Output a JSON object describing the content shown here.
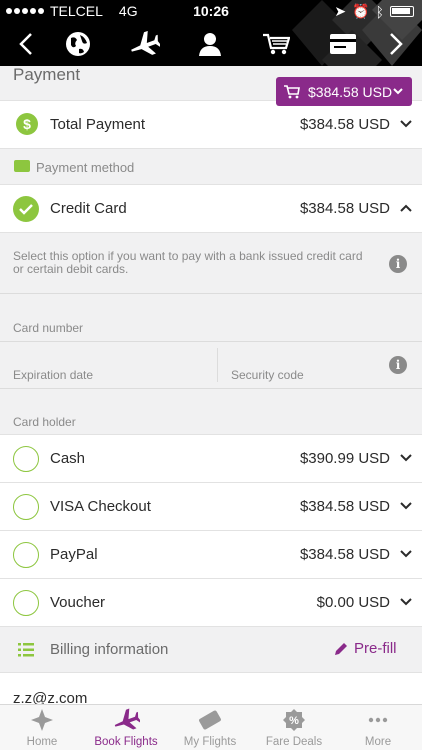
{
  "status": {
    "carrier": "TELCEL",
    "network": "4G",
    "time": "10:26"
  },
  "nav": {
    "items": [
      "back",
      "globe",
      "flight",
      "user",
      "cart",
      "payment",
      "forward"
    ]
  },
  "page": {
    "title": "Payment",
    "cart_total": "$384.58 USD"
  },
  "total": {
    "label": "Total Payment",
    "amount": "$384.58 USD"
  },
  "payment_method": {
    "label": "Payment method"
  },
  "credit_card": {
    "label": "Credit Card",
    "amount": "$384.58 USD",
    "description": "Select this option if you want to pay with a bank issued credit card or certain debit cards.",
    "fields": {
      "card_number": "Card number",
      "expiration": "Expiration date",
      "security": "Security code",
      "holder": "Card holder"
    }
  },
  "options": [
    {
      "label": "Cash",
      "amount": "$390.99 USD"
    },
    {
      "label": "VISA Checkout",
      "amount": "$384.58 USD"
    },
    {
      "label": "PayPal",
      "amount": "$384.58 USD"
    },
    {
      "label": "Voucher",
      "amount": "$0.00 USD"
    }
  ],
  "billing": {
    "label": "Billing information",
    "prefill": "Pre-fill",
    "email_partial": "z.z@z.com"
  },
  "tabs": [
    {
      "label": "Home"
    },
    {
      "label": "Book Flights"
    },
    {
      "label": "My Flights"
    },
    {
      "label": "Fare Deals"
    },
    {
      "label": "More"
    }
  ],
  "colors": {
    "accent": "#8a2a8a",
    "green": "#8dc63f",
    "bar": "#000000"
  }
}
